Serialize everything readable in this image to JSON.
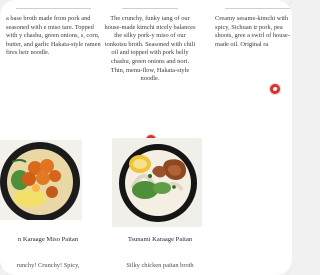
{
  "menu": {
    "col1": {
      "desc": "a base broth made from pork and seasoned with e miso tare. Topped with y chashu, green onions, s, corn, butter, and garlic Hakata-style ramen fires heir noodle."
    },
    "col2": {
      "desc": "The crunchy, funky tang of our house-made kimchi nicely balances the silky pork-y miso of our tonkotsu broth. Seasoned with chili oil and topped with pork belly chashu, green onions and nori. Thin, menu-flow, Hakata-style noodle."
    },
    "col3": {
      "desc": "Creamy sesame-kimchi with spicy, Sichuan tr pork, pea shoots, gree a swirl of house-made oil. Original ra"
    },
    "items": [
      {
        "name": "n Karaage Miso Paitan",
        "preview": "runchy! Crunchy! Spicy,"
      },
      {
        "name": "Tsunami Karaage Paitan",
        "preview": "Silky chicken paitan broth"
      }
    ]
  },
  "colors": {
    "spicy": "#d6322f",
    "card": "#ffffff",
    "background": "#f1f1f1"
  },
  "icons": [
    "chili-spicy-icon",
    "chili-spicy-icon"
  ]
}
